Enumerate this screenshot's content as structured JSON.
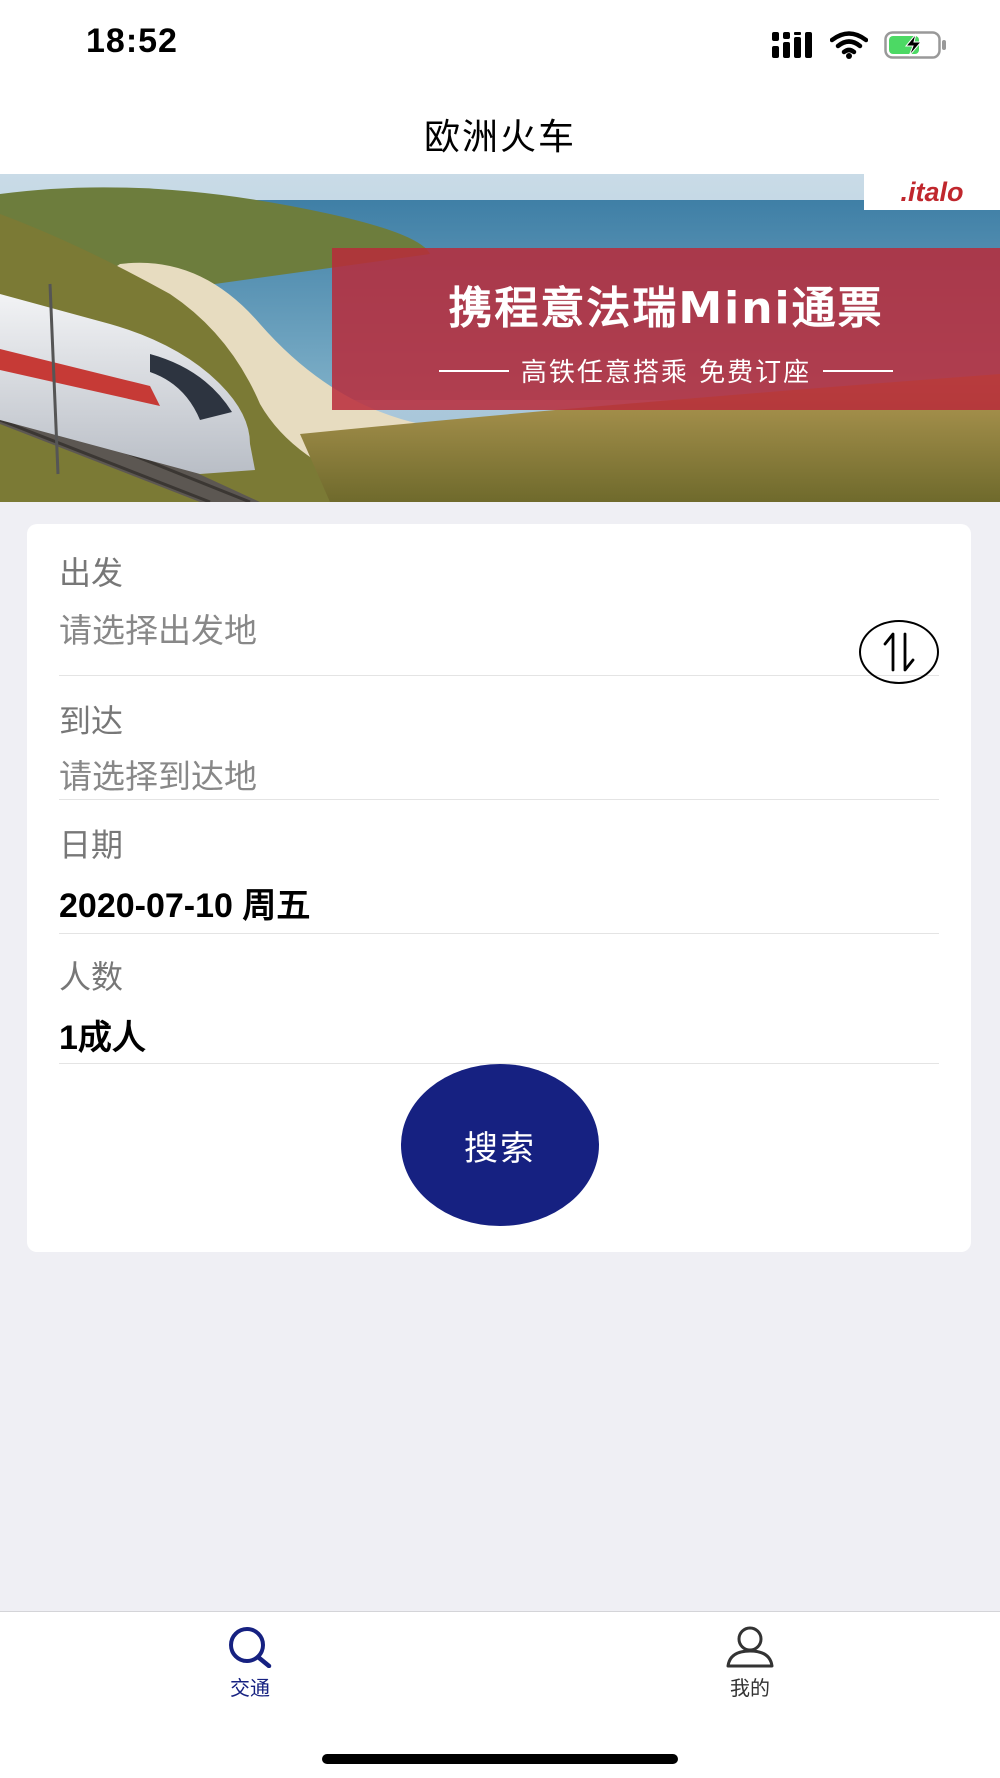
{
  "status_bar": {
    "time": "18:52"
  },
  "nav": {
    "title": "欧洲火车"
  },
  "banner": {
    "logo_text": ".italo",
    "promo_title": "携程意法瑞Mini通票",
    "promo_subtitle": "高铁任意搭乘 免费订座"
  },
  "form": {
    "departure": {
      "label": "出发",
      "placeholder": "请选择出发地"
    },
    "arrival": {
      "label": "到达",
      "placeholder": "请选择到达地"
    },
    "date": {
      "label": "日期",
      "value": "2020-07-10 周五"
    },
    "passengers": {
      "label": "人数",
      "value": "1成人"
    },
    "search_label": "搜索"
  },
  "tabs": [
    {
      "label": "交通",
      "icon": "search-icon",
      "active": true
    },
    {
      "label": "我的",
      "icon": "user-icon",
      "active": false
    }
  ],
  "colors": {
    "accent": "#162181",
    "promo_red": "#b82a3a",
    "background": "#efeff4"
  }
}
